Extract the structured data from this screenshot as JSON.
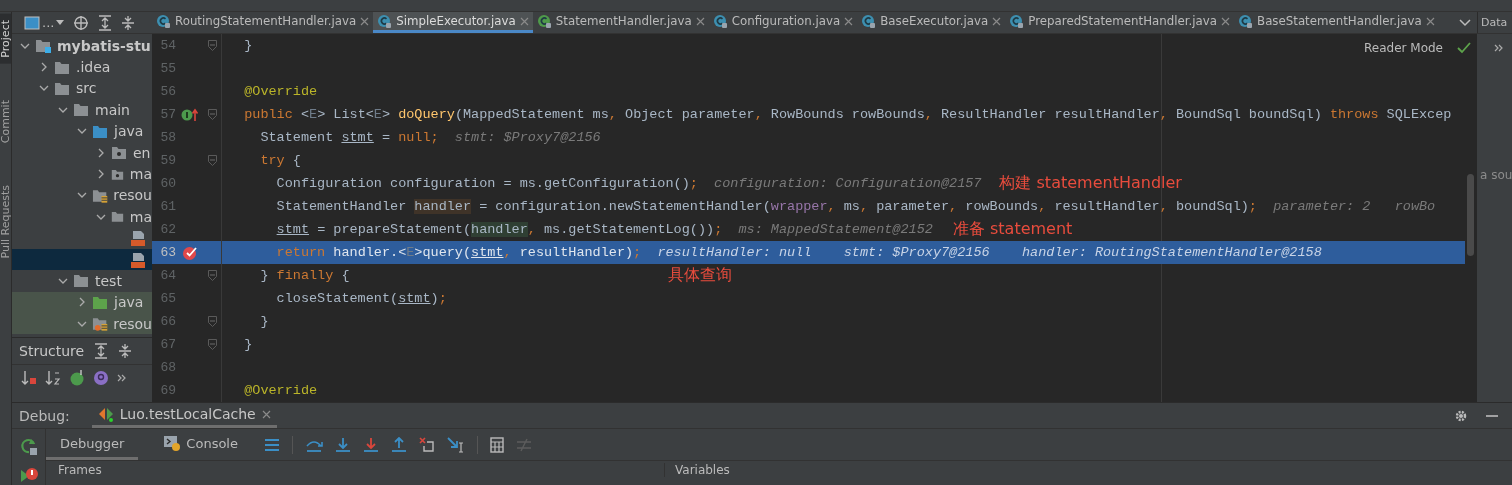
{
  "side_tabs": [
    {
      "label": "Project",
      "selected": true
    },
    {
      "label": "Commit",
      "selected": false
    },
    {
      "label": "Pull Requests",
      "selected": false
    }
  ],
  "tool_label": "...",
  "editor_tabs": [
    {
      "label": "RoutingStatementHandler.java",
      "kind": "class",
      "selected": false
    },
    {
      "label": "SimpleExecutor.java",
      "kind": "class",
      "selected": true
    },
    {
      "label": "StatementHandler.java",
      "kind": "interface",
      "selected": false
    },
    {
      "label": "Configuration.java",
      "kind": "class",
      "selected": false
    },
    {
      "label": "BaseExecutor.java",
      "kind": "class",
      "selected": false
    },
    {
      "label": "PreparedStatementHandler.java",
      "kind": "class",
      "selected": false
    },
    {
      "label": "BaseStatementHandler.java",
      "kind": "class",
      "selected": false
    }
  ],
  "right_panel": {
    "tab": "Data",
    "hint": "a sou"
  },
  "project_tree": [
    {
      "label": "mybatis-stu",
      "kind": "module",
      "expanded": true,
      "selected": false,
      "test_scope": false,
      "children": [
        {
          "label": ".idea",
          "kind": "folder",
          "expanded": false,
          "selected": false,
          "test_scope": false
        },
        {
          "label": "src",
          "kind": "folder",
          "expanded": true,
          "selected": false,
          "test_scope": false,
          "children": [
            {
              "label": "main",
              "kind": "folder",
              "expanded": true,
              "selected": false,
              "test_scope": false,
              "children": [
                {
                  "label": "java",
                  "kind": "source-folder",
                  "expanded": true,
                  "selected": false,
                  "test_scope": false,
                  "children": [
                    {
                      "label": "en",
                      "kind": "package",
                      "expanded": false,
                      "selected": false,
                      "test_scope": false
                    },
                    {
                      "label": "ma",
                      "kind": "package",
                      "expanded": false,
                      "selected": false,
                      "test_scope": false
                    }
                  ]
                },
                {
                  "label": "resou",
                  "kind": "resources-folder",
                  "expanded": true,
                  "selected": false,
                  "test_scope": false,
                  "children": [
                    {
                      "label": "ma",
                      "kind": "folder",
                      "expanded": true,
                      "selected": false,
                      "test_scope": false,
                      "children": [
                        {
                          "kind": "xml-file",
                          "selected": false,
                          "test_scope": false
                        },
                        {
                          "kind": "xml-file",
                          "selected": true,
                          "test_scope": false
                        }
                      ]
                    }
                  ]
                }
              ]
            },
            {
              "label": "test",
              "kind": "folder",
              "expanded": true,
              "selected": false,
              "test_scope": false,
              "children": [
                {
                  "label": "java",
                  "kind": "test-folder",
                  "expanded": false,
                  "selected": false,
                  "test_scope": true
                },
                {
                  "label": "resou",
                  "kind": "test-resources-folder",
                  "expanded": true,
                  "selected": false,
                  "test_scope": true
                }
              ]
            }
          ]
        }
      ]
    }
  ],
  "structure": {
    "title": "Structure"
  },
  "editor": {
    "reader_mode": "Reader Mode",
    "lines": [
      {
        "number": "54",
        "fold": true,
        "kind": "plain",
        "current": false,
        "segments": [
          {
            "text": "  }",
            "kind": "plain"
          }
        ]
      },
      {
        "number": "55",
        "fold": false,
        "kind": "plain",
        "current": false
      },
      {
        "number": "56",
        "fold": false,
        "kind": "plain",
        "current": false,
        "segments": [
          {
            "text": "  @Override",
            "kind": "annotation"
          }
        ]
      },
      {
        "number": "57",
        "fold": true,
        "kind": "override",
        "current": false,
        "segments": [
          {
            "text": "  public ",
            "kind": "keyword"
          },
          {
            "text": "<",
            "kind": "plain"
          },
          {
            "text": "E",
            "kind": "type-param"
          },
          {
            "text": "> List<",
            "kind": "plain"
          },
          {
            "text": "E",
            "kind": "type-param"
          },
          {
            "text": "> ",
            "kind": "plain"
          },
          {
            "text": "doQuery",
            "kind": "method"
          },
          {
            "text": "(MappedStatement ms",
            "kind": "plain"
          },
          {
            "text": ", ",
            "kind": "keyword"
          },
          {
            "text": "Object parameter",
            "kind": "plain"
          },
          {
            "text": ", ",
            "kind": "keyword"
          },
          {
            "text": "RowBounds rowBounds",
            "kind": "plain"
          },
          {
            "text": ", ",
            "kind": "keyword"
          },
          {
            "text": "ResultHandler resultHandler",
            "kind": "plain"
          },
          {
            "text": ", ",
            "kind": "keyword"
          },
          {
            "text": "BoundSql boundSql) ",
            "kind": "plain"
          },
          {
            "text": "throws ",
            "kind": "keyword"
          },
          {
            "text": "SQLExcep",
            "kind": "plain"
          }
        ]
      },
      {
        "number": "58",
        "fold": false,
        "kind": "plain",
        "current": false,
        "segments": [
          {
            "text": "    Statement ",
            "kind": "plain"
          },
          {
            "text": "stmt",
            "kind": "var"
          },
          {
            "text": " = ",
            "kind": "plain"
          },
          {
            "text": "null;",
            "kind": "keyword"
          },
          {
            "text": "  stmt: $Proxy7@2156",
            "kind": "hint"
          }
        ]
      },
      {
        "number": "59",
        "fold": true,
        "kind": "plain",
        "current": false,
        "segments": [
          {
            "text": "    try ",
            "kind": "keyword"
          },
          {
            "text": "{",
            "kind": "plain"
          }
        ]
      },
      {
        "number": "60",
        "fold": false,
        "kind": "plain",
        "current": false,
        "segments": [
          {
            "text": "      Configuration configuration = ms.getConfiguration()",
            "kind": "plain"
          },
          {
            "text": ";",
            "kind": "keyword"
          },
          {
            "text": "  configuration: Configuration@2157",
            "kind": "hint"
          }
        ],
        "note": "构建 statementHandler"
      },
      {
        "number": "61",
        "fold": false,
        "kind": "plain",
        "current": false,
        "segments": [
          {
            "text": "      StatementHandler ",
            "kind": "plain"
          },
          {
            "text": "handler",
            "kind": "write-usage"
          },
          {
            "text": " = configuration.newStatementHandler(",
            "kind": "plain"
          },
          {
            "text": "wrapper",
            "kind": "field"
          },
          {
            "text": ", ",
            "kind": "keyword"
          },
          {
            "text": "ms",
            "kind": "plain"
          },
          {
            "text": ", ",
            "kind": "keyword"
          },
          {
            "text": "parameter",
            "kind": "plain"
          },
          {
            "text": ", ",
            "kind": "keyword"
          },
          {
            "text": "rowBounds",
            "kind": "plain"
          },
          {
            "text": ", ",
            "kind": "keyword"
          },
          {
            "text": "resultHandler",
            "kind": "plain"
          },
          {
            "text": ", ",
            "kind": "keyword"
          },
          {
            "text": "boundSql)",
            "kind": "plain"
          },
          {
            "text": ";",
            "kind": "keyword"
          },
          {
            "text": "  parameter: 2",
            "kind": "hint"
          },
          {
            "text": "   rowBo",
            "kind": "hint"
          }
        ]
      },
      {
        "number": "62",
        "fold": false,
        "kind": "plain",
        "current": false,
        "segments": [
          {
            "text": "      stmt",
            "kind": "var"
          },
          {
            "text": " = prepareStatement(",
            "kind": "plain"
          },
          {
            "text": "handler",
            "kind": "read-usage"
          },
          {
            "text": ", ",
            "kind": "keyword"
          },
          {
            "text": "ms.getStatementLog())",
            "kind": "plain"
          },
          {
            "text": ";",
            "kind": "keyword"
          },
          {
            "text": "  ms: MappedStatement@2152",
            "kind": "hint"
          }
        ],
        "note": "准备 statement"
      },
      {
        "number": "63",
        "fold": false,
        "kind": "breakpoint",
        "current": true,
        "segments": [
          {
            "text": "      return ",
            "kind": "keyword"
          },
          {
            "text": "handler.<",
            "kind": "plain"
          },
          {
            "text": "E",
            "kind": "type-param"
          },
          {
            "text": ">query(",
            "kind": "plain"
          },
          {
            "text": "stmt",
            "kind": "var"
          },
          {
            "text": ", ",
            "kind": "keyword"
          },
          {
            "text": "resultHandler)",
            "kind": "plain"
          },
          {
            "text": ";",
            "kind": "keyword"
          },
          {
            "text": "  resultHandler: null",
            "kind": "hint"
          },
          {
            "text": "    stmt: $Proxy7@2156",
            "kind": "hint"
          },
          {
            "text": "    handler: RoutingStatementHandler@2158",
            "kind": "hint"
          }
        ]
      },
      {
        "number": "64",
        "fold": true,
        "kind": "plain",
        "current": false,
        "segments": [
          {
            "text": "    } ",
            "kind": "plain"
          },
          {
            "text": "finally ",
            "kind": "keyword"
          },
          {
            "text": "{",
            "kind": "plain"
          }
        ],
        "note": "具体查询"
      },
      {
        "number": "65",
        "fold": false,
        "kind": "plain",
        "current": false,
        "segments": [
          {
            "text": "      closeStatement(",
            "kind": "plain"
          },
          {
            "text": "stmt",
            "kind": "var"
          },
          {
            "text": ")",
            "kind": "plain"
          },
          {
            "text": ";",
            "kind": "keyword"
          }
        ]
      },
      {
        "number": "66",
        "fold": true,
        "kind": "plain",
        "current": false,
        "segments": [
          {
            "text": "    }",
            "kind": "plain"
          }
        ]
      },
      {
        "number": "67",
        "fold": true,
        "kind": "plain",
        "current": false,
        "segments": [
          {
            "text": "  }",
            "kind": "plain"
          }
        ]
      },
      {
        "number": "68",
        "fold": false,
        "kind": "plain",
        "current": false
      },
      {
        "number": "69",
        "fold": false,
        "kind": "plain",
        "current": false,
        "segments": [
          {
            "text": "  @Override",
            "kind": "annotation"
          }
        ]
      }
    ]
  },
  "debug": {
    "label": "Debug:",
    "session_tab": "Luo.testLocalCache",
    "tabs": [
      {
        "label": "Debugger",
        "kind": "debugger",
        "selected": true
      },
      {
        "label": "Console",
        "kind": "console",
        "selected": false
      }
    ],
    "frames": "Frames",
    "variables": "Variables"
  }
}
